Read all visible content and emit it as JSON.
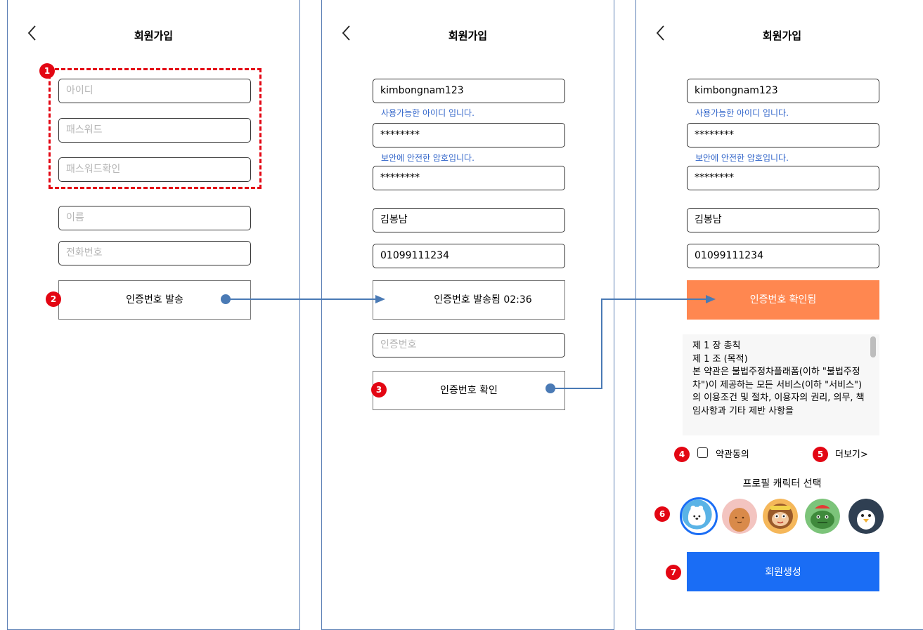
{
  "header": {
    "title": "회원가입"
  },
  "screen1": {
    "id_placeholder": "아이디",
    "password_placeholder": "패스워드",
    "password_confirm_placeholder": "패스워드확인",
    "name_placeholder": "이름",
    "phone_placeholder": "전화번호",
    "send_code_label": "인증번호 발송"
  },
  "screen2": {
    "id_value": "kimbongnam123",
    "id_hint": "사용가능한 아이디 입니다.",
    "password_value": "********",
    "password_hint": "보안에 안전한 암호입니다.",
    "password_confirm_value": "********",
    "name_value": "김봉남",
    "phone_value": "01099111234",
    "sent_label": "인증번호 발송됨 02:36",
    "code_placeholder": "인증번호",
    "verify_label": "인증번호 확인"
  },
  "screen3": {
    "id_value": "kimbongnam123",
    "id_hint": "사용가능한 아이디 입니다.",
    "password_value": "********",
    "password_hint": "보안에 안전한 암호입니다.",
    "password_confirm_value": "********",
    "name_value": "김봉남",
    "phone_value": "01099111234",
    "verified_label": "인증번호 확인됨",
    "terms_text": "제 1 장 총칙\n제 1 조 (목적)\n본 약관은 불법주정차플래폼(이하 \"불법주정차\")이 제공하는 모든 서비스(이하 \"서비스\")의 이용조건 및 절차, 이용자의 권리, 의무, 책임사항과 기타 제반 사항을",
    "agree_label": "약관동의",
    "more_label": "더보기>",
    "profile_label": "프로필 캐릭터 선택",
    "create_label": "회원생성"
  },
  "badges": [
    "1",
    "2",
    "3",
    "4",
    "5",
    "6",
    "7"
  ],
  "colors": {
    "accent_blue": "#1a6df5",
    "verified_orange": "#ff8750",
    "hint_blue": "#2f63c9",
    "annotation_red": "#e30613",
    "arrow_blue": "#4a7ab5"
  },
  "icons": [
    "chevron-left-icon",
    "checkbox-icon",
    "polar-bear-avatar",
    "potato-avatar",
    "monkey-avatar",
    "dinosaur-avatar",
    "penguin-avatar"
  ]
}
